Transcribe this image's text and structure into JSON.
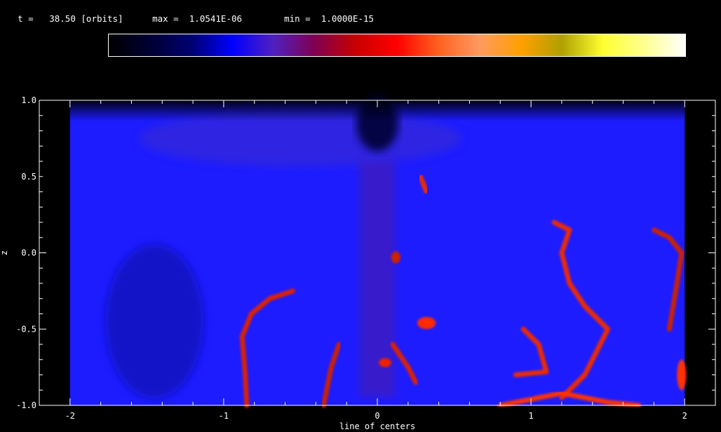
{
  "header": {
    "time_label": "t =",
    "time_value": "38.50",
    "time_unit": "[orbits]",
    "max_label": "max =",
    "max_value": "1.0541E-06",
    "min_label": "min =",
    "min_value": "1.0000E-15"
  },
  "colorbar": {
    "stops": [
      "#000000",
      "#000033",
      "#000070",
      "#0000ff",
      "#5020c0",
      "#800050",
      "#c80000",
      "#ff0000",
      "#ff6020",
      "#ff9a60",
      "#ffa000",
      "#b0a000",
      "#ffff30",
      "#ffff90",
      "#ffffff"
    ]
  },
  "chart_data": {
    "type": "heatmap",
    "title": "",
    "xlabel": "line of centers",
    "ylabel": "z",
    "xlim": [
      -2.2,
      2.2
    ],
    "ylim": [
      -1.0,
      1.0
    ],
    "x_ticks": [
      "-2",
      "-1",
      "0",
      "1",
      "2"
    ],
    "x_tick_values": [
      -2,
      -1,
      0,
      1,
      2
    ],
    "y_ticks": [
      "1.0",
      "0.5",
      "0.0",
      "-0.5",
      "-1.0"
    ],
    "y_tick_values": [
      1.0,
      0.5,
      0.0,
      -0.5,
      -1.0
    ],
    "background_color": "#1c1cff",
    "features": [
      {
        "name": "filament",
        "color": "#dd2200",
        "points": [
          [
            -0.85,
            -1.0
          ],
          [
            -0.86,
            -0.8
          ],
          [
            -0.88,
            -0.55
          ],
          [
            -0.82,
            -0.4
          ],
          [
            -0.7,
            -0.3
          ],
          [
            -0.55,
            -0.25
          ]
        ]
      },
      {
        "name": "filament",
        "color": "#ee2a00",
        "points": [
          [
            0.28,
            0.5
          ],
          [
            0.3,
            0.45
          ],
          [
            0.32,
            0.4
          ]
        ]
      },
      {
        "name": "filament",
        "color": "#ee2a00",
        "points": [
          [
            1.2,
            -0.95
          ],
          [
            1.35,
            -0.8
          ],
          [
            1.5,
            -0.5
          ],
          [
            1.35,
            -0.35
          ],
          [
            1.25,
            -0.2
          ],
          [
            1.2,
            0.0
          ],
          [
            1.25,
            0.15
          ],
          [
            1.15,
            0.2
          ]
        ]
      },
      {
        "name": "filament",
        "color": "#ee2a00",
        "points": [
          [
            0.9,
            -0.8
          ],
          [
            1.1,
            -0.78
          ],
          [
            1.05,
            -0.6
          ],
          [
            0.95,
            -0.5
          ]
        ]
      },
      {
        "name": "filament",
        "color": "#cc2200",
        "points": [
          [
            -0.25,
            -0.6
          ],
          [
            -0.3,
            -0.75
          ],
          [
            -0.35,
            -1.0
          ]
        ]
      },
      {
        "name": "filament",
        "color": "#cc2200",
        "points": [
          [
            1.8,
            0.15
          ],
          [
            1.9,
            0.1
          ],
          [
            1.98,
            0.0
          ],
          [
            1.95,
            -0.2
          ],
          [
            1.9,
            -0.5
          ]
        ]
      },
      {
        "name": "filament",
        "color": "#dd2200",
        "points": [
          [
            0.1,
            -0.6
          ],
          [
            0.2,
            -0.75
          ],
          [
            0.25,
            -0.85
          ]
        ]
      },
      {
        "name": "filament",
        "color": "#ff3300",
        "points": [
          [
            0.8,
            -1.0
          ],
          [
            1.2,
            -0.92
          ],
          [
            1.5,
            -0.98
          ],
          [
            1.7,
            -1.0
          ]
        ]
      }
    ],
    "blobs": [
      {
        "x": 0.32,
        "y": -0.46,
        "rx": 0.06,
        "ry": 0.04,
        "color": "#ff2a00"
      },
      {
        "x": 0.05,
        "y": -0.72,
        "rx": 0.04,
        "ry": 0.03,
        "color": "#ee2200"
      },
      {
        "x": 0.12,
        "y": -0.03,
        "rx": 0.03,
        "ry": 0.04,
        "color": "#cc2200"
      },
      {
        "x": 1.98,
        "y": -0.8,
        "rx": 0.03,
        "ry": 0.1,
        "color": "#ff3300"
      }
    ]
  }
}
